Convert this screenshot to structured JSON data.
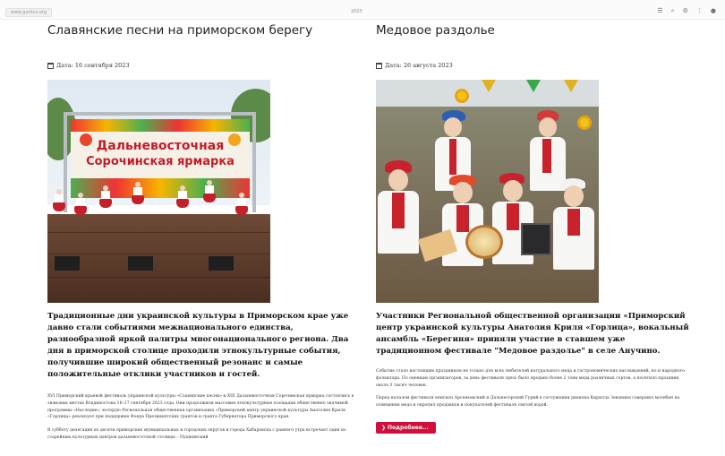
{
  "topbar": {
    "url": "www.gorlica.org",
    "year": "2023",
    "icons": [
      "list-icon",
      "search-icon",
      "settings-icon",
      "menu-icon",
      "user-icon"
    ]
  },
  "articles": [
    {
      "title": "Славянские песни на приморском берегу",
      "date_label": "Дата: 16 сентября 2023",
      "photo_banner_line1": "Дальневосточная",
      "photo_banner_line2": "Сорочинская ярмарка",
      "lead": "Традиционные дни украинской культуры в Приморском крае уже давно стали событиями межнационального единства, разнообразной яркой палитры многонационального региона. Два дня в приморской столице проходили этнокультурные события, получившие широкий общественный резонанс и самые положительные отклики участников и гостей.",
      "body": [
        "XVI Приморский краевой фестиваль украинской культуры «Славянские песни» и XIII Дальневосточная Сорочинская ярмарка состоялись в знаковых местах Владивостока 16–17 сентября 2023 года. Они продолжили массовые этнокультурные площадки общественно значимой программы «Наследие», которую Региональная общественная организация «Приморский центр украинской культуры Анатолия Криля «Горлица» реализует при поддержке Фонда Президентских грантов и гранта Губернатора Приморского края.",
        "В субботу делегация из десяти приморских муниципальных и городских округов и города Хабаровска с раннего утра встречает один из старейших культурных центров дальневосточной столицы – Пушкинский"
      ]
    },
    {
      "title": "Медовое раздолье",
      "date_label": "Дата: 26 августа 2023",
      "lead": "Участники Региональной общественной организации «Приморский центр украинской культуры Анатолия Криля «Горлица», вокальный ансамбль «Берегиня» приняли участие в ставшем уже традиционном фестивале \"Медовое раздолье\" в селе Анучино.",
      "body": [
        "Событие стало настоящим праздником не только для всех любителей натурального меда и гастрономических наслаждений, но и народного фольклора. По оценкам организаторов, за день фестиваля здесь было продано более 2 тонн меда различных сортов, а посетило праздник около 3 тысяч человек.",
        "Перед началом фестиваля епископ Арсеньевский и Дальнегорский Гурий в сослужении диакона Кирилла Зевакина совершил молебен на освящение меда и окропил продавцов и покупателей фестиваля святой водой."
      ],
      "more_label": "Подробнее..."
    }
  ]
}
